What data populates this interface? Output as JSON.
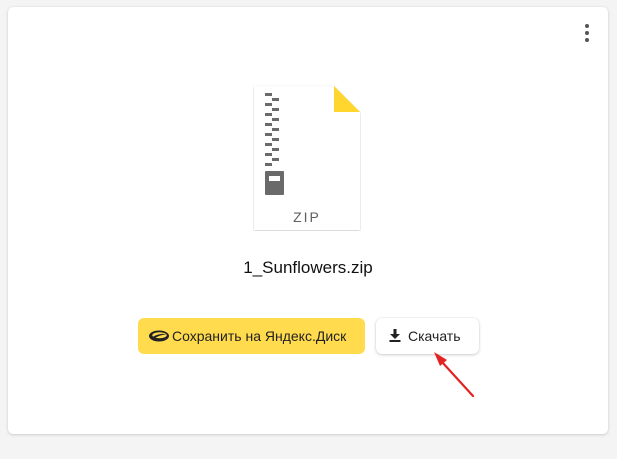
{
  "file": {
    "type_label": "ZIP",
    "name": "1_Sunflowers.zip",
    "icon": "zip-archive-file-icon"
  },
  "actions": {
    "save_label": "Сохранить на Яндекс.Диск",
    "save_icon": "yandex-disk-icon",
    "download_label": "Скачать",
    "download_icon": "download-icon",
    "more_icon": "more-vertical-icon"
  },
  "colors": {
    "page_background": "#f4f4f4",
    "card_background": "#ffffff",
    "save_button": "#ffdb4d",
    "file_corner": "#ffdb4d",
    "annotation_arrow": "#e32222"
  }
}
